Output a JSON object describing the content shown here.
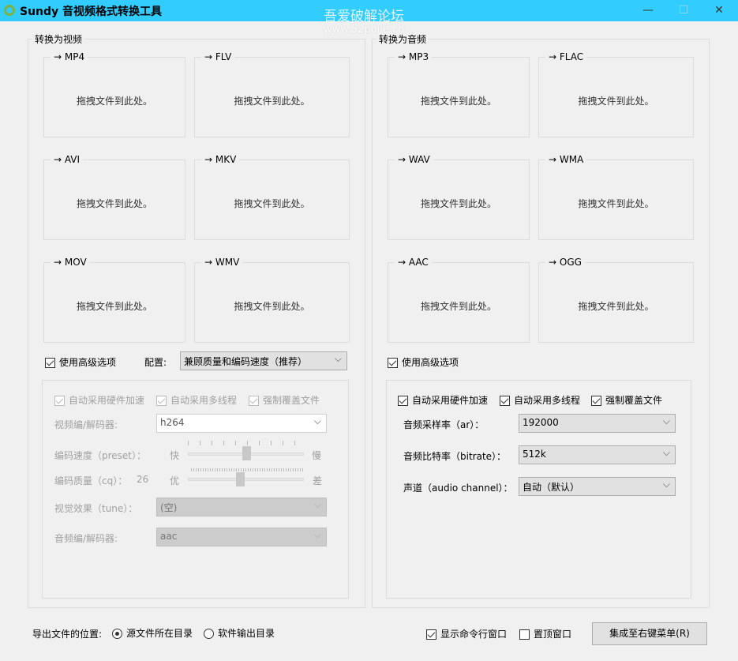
{
  "window": {
    "title": "Sundy 音视频格式转换工具",
    "watermark_line1": "吾爱破解论坛",
    "watermark_line2": "www.52pojie.cn",
    "minimize": "—",
    "maximize": "☐",
    "close": "✕"
  },
  "drop_hint": "拖拽文件到此处。",
  "video": {
    "group_label": "转换为视频",
    "formats": [
      "→ MP4",
      "→ FLV",
      "→ AVI",
      "→ MKV",
      "→ MOV",
      "→ WMV"
    ],
    "advanced_label": "使用高级选项",
    "advanced_checked": true,
    "config_label": "配置:",
    "config_value": "兼顾质量和编码速度（推荐）",
    "hw_accel": "自动采用硬件加速",
    "multithread": "自动采用多线程",
    "overwrite": "强制覆盖文件",
    "video_codec_label": "视频编/解码器:",
    "video_codec_value": "h264",
    "preset_label": "编码速度（preset）：",
    "preset_fast": "快",
    "preset_slow": "慢",
    "preset_position": 0.5,
    "cq_label": "编码质量（cq）：",
    "cq_value": "26",
    "cq_good": "优",
    "cq_bad": "差",
    "cq_position": 0.45,
    "tune_label": "视觉效果（tune）：",
    "tune_value": "(空)",
    "audio_codec_label": "音频编/解码器:",
    "audio_codec_value": "aac"
  },
  "audio": {
    "group_label": "转换为音频",
    "formats": [
      "→ MP3",
      "→ FLAC",
      "→ WAV",
      "→ WMA",
      "→ AAC",
      "→ OGG"
    ],
    "advanced_label": "使用高级选项",
    "advanced_checked": true,
    "hw_accel": "自动采用硬件加速",
    "multithread": "自动采用多线程",
    "overwrite": "强制覆盖文件",
    "ar_label": "音频采样率（ar）：",
    "ar_value": "192000",
    "bitrate_label": "音频比特率（bitrate）：",
    "bitrate_value": "512k",
    "channel_label": "声道（audio channel）：",
    "channel_value": "自动（默认）"
  },
  "footer": {
    "output_label": "导出文件的位置:",
    "opt_source": "源文件所在目录",
    "opt_software": "软件输出目录",
    "show_cmd": "显示命令行窗口",
    "topmost": "置顶窗口",
    "context_menu_button": "集成至右键菜单(R)"
  }
}
